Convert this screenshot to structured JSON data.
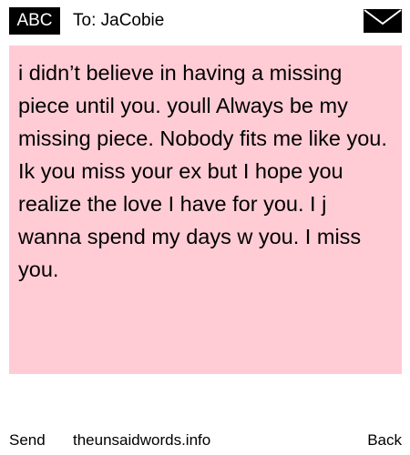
{
  "header": {
    "badge_label": "ABC",
    "recipient": "To: JaCobie"
  },
  "message": {
    "body": "i didn’t believe in having a missing piece until you. youll Always be my missing piece. Nobody fits me like you. Ik you miss your ex but I hope you realize the love I have for you. I j wanna spend my days w you. I miss you."
  },
  "footer": {
    "send_label": "Send",
    "site_label": "theunsaidwords.info",
    "back_label": "Back"
  },
  "icons": {
    "envelope": "envelope-icon"
  },
  "colors": {
    "badge_background": "#000000",
    "message_background": "#ffccd5",
    "page_background": "#ffffff",
    "text": "#000000"
  }
}
